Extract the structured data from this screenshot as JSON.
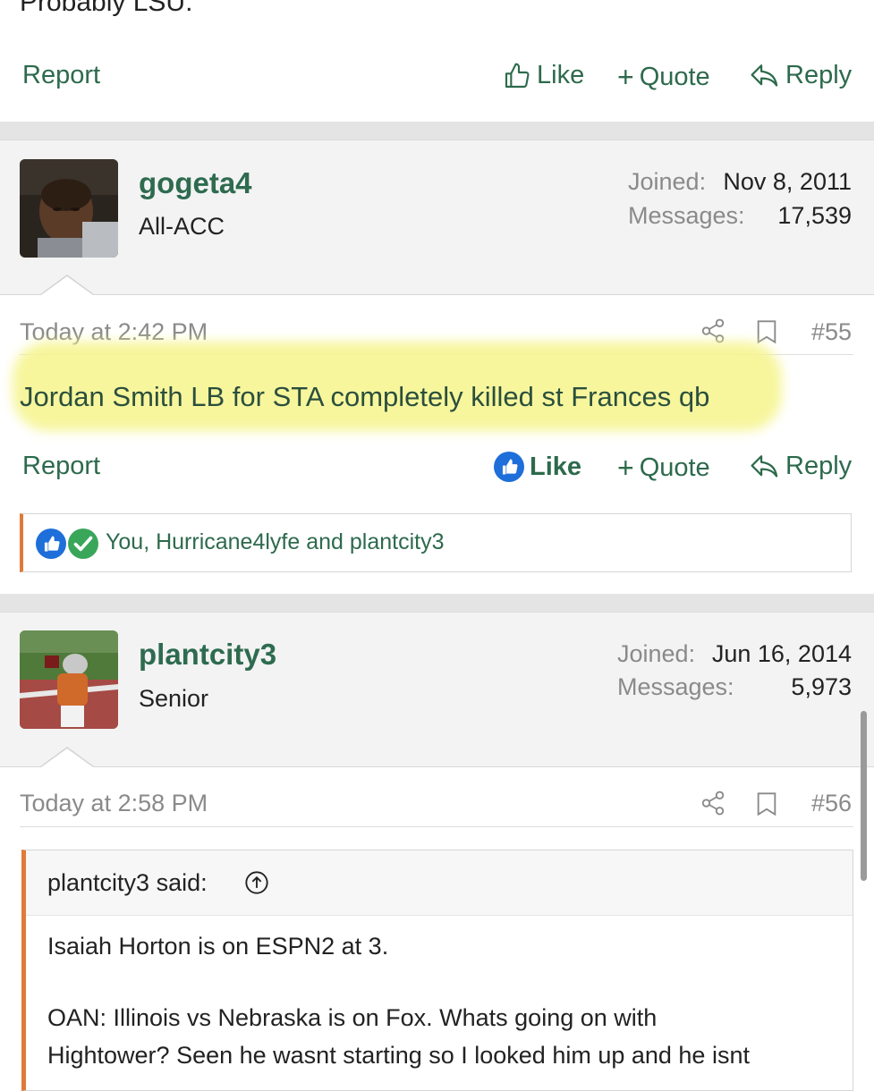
{
  "prev_post": {
    "tail_text": "Probably LSU.",
    "report_label": "Report",
    "like_label": "Like",
    "quote_label": "Quote",
    "reply_label": "Reply"
  },
  "post_55": {
    "username": "gogeta4",
    "user_title": "All-ACC",
    "joined_label": "Joined:",
    "joined_value": "Nov 8, 2011",
    "messages_label": "Messages:",
    "messages_value": "17,539",
    "timestamp": "Today at 2:42 PM",
    "post_number": "#55",
    "message": "Jordan Smith LB for STA completely killed st Frances qb",
    "report_label": "Report",
    "like_label": "Like",
    "quote_label": "Quote",
    "reply_label": "Reply",
    "likes_text": "You, Hurricane4lyfe and plantcity3"
  },
  "post_56": {
    "username": "plantcity3",
    "user_title": "Senior",
    "joined_label": "Joined:",
    "joined_value": "Jun 16, 2014",
    "messages_label": "Messages:",
    "messages_value": "5,973",
    "timestamp": "Today at 2:58 PM",
    "post_number": "#56",
    "quote_author": "plantcity3 said:",
    "quote_line1": "Isaiah Horton is on ESPN2 at 3.",
    "quote_line2": "OAN: Illinois vs Nebraska is on Fox. Whats going on with",
    "quote_line3": "Hightower? Seen he wasnt starting so I looked him up and he isnt"
  },
  "colors": {
    "link_green": "#2d6a4c",
    "username_green": "#2e6b4f",
    "like_blue": "#1e6fd9",
    "accent_orange": "#e07a3a",
    "highlight_yellow": "#f6f58c"
  },
  "icons": [
    "thumbs-up-icon",
    "plus-icon",
    "reply-arrow-icon",
    "share-icon",
    "bookmark-icon",
    "like-reaction-icon",
    "check-reaction-icon",
    "arrow-up-circle-icon"
  ]
}
